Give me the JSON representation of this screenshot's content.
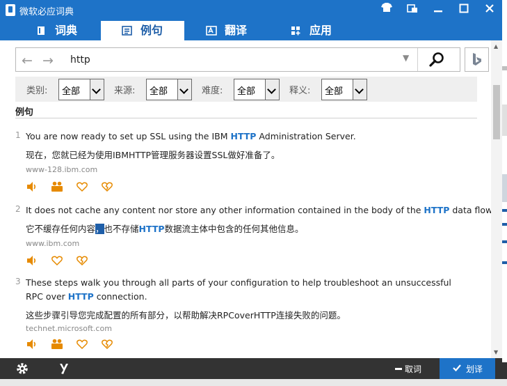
{
  "window": {
    "title": "微软必应词典"
  },
  "tabs": [
    {
      "label": "词典",
      "icon": "book-icon"
    },
    {
      "label": "例句",
      "icon": "list-icon"
    },
    {
      "label": "翻译",
      "icon": "translate-icon"
    },
    {
      "label": "应用",
      "icon": "apps-icon"
    }
  ],
  "search": {
    "value": "http"
  },
  "filters": [
    {
      "label": "类别:",
      "value": "全部"
    },
    {
      "label": "来源:",
      "value": "全部"
    },
    {
      "label": "难度:",
      "value": "全部"
    },
    {
      "label": "释义:",
      "value": "全部"
    }
  ],
  "section_title": "例句",
  "examples": [
    {
      "num": "1",
      "en_before": "You are now ready to set up SSL using the IBM ",
      "en_hl": "HTTP",
      "en_after": " Administration Server.",
      "zh_before": "现在，您就已经为使用IBMHTTP管理服务器设置SSL做好准备了。",
      "zh_sel": "",
      "zh_mid": "",
      "zh_hl": "",
      "zh_after": "",
      "source": "www-128.ibm.com"
    },
    {
      "num": "2",
      "en_before": "It does not cache any content nor store any other information contained in the body of the ",
      "en_hl": "HTTP",
      "en_after": " data flow.",
      "zh_before": "它不缓存任何内容",
      "zh_sel": "，",
      "zh_mid": "也不存储",
      "zh_hl": "HTTP",
      "zh_after": "数据流主体中包含的任何其他信息。",
      "source": "www.ibm.com"
    },
    {
      "num": "3",
      "en_before": "These steps walk you through all parts of your configuration to help troubleshoot an unsuccessful RPC over ",
      "en_hl": "HTTP",
      "en_after": " connection.",
      "zh_before": "这些步骤引导您完成配置的所有部分，以帮助解决RPCoverHTTP连接失败的问题。",
      "zh_sel": "",
      "zh_mid": "",
      "zh_hl": "",
      "zh_after": "",
      "source": "technet.microsoft.com"
    }
  ],
  "bottom": {
    "cancel_label": "取词",
    "translate_label": "划译"
  },
  "colors": {
    "accent": "#1e73c8",
    "action": "#e68a00",
    "bottombar": "#333333"
  }
}
